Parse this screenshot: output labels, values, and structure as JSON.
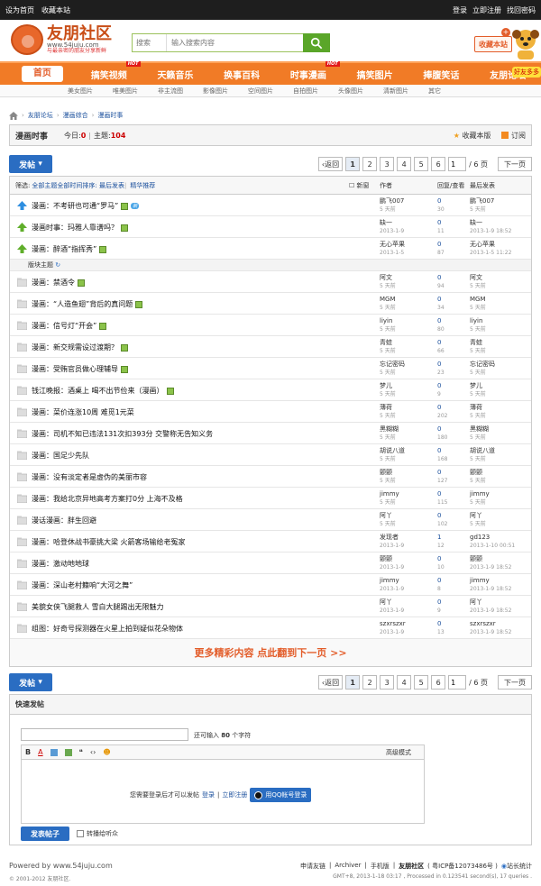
{
  "topbar": {
    "left": [
      "设为首页",
      "收藏本站"
    ],
    "right": [
      "登录",
      "立即注册",
      "找回密码"
    ]
  },
  "logo": {
    "title": "友朋社区",
    "url": "www.54juju.com",
    "slogan": "与最亲密的朋友分享新鲜"
  },
  "search": {
    "type": "搜索",
    "placeholder": "输入搜索内容"
  },
  "header": {
    "fav": "收藏本站",
    "badge": "好友多多"
  },
  "nav": [
    {
      "label": "首页",
      "hot": ""
    },
    {
      "label": "搞笑视频",
      "hot": "HOT"
    },
    {
      "label": "天籁音乐",
      "hot": ""
    },
    {
      "label": "换事百科",
      "hot": ""
    },
    {
      "label": "时事漫画",
      "hot": "HOT"
    },
    {
      "label": "搞笑图片",
      "hot": ""
    },
    {
      "label": "捧腹笑话",
      "hot": ""
    },
    {
      "label": "友朋论坛",
      "hot": ""
    }
  ],
  "subnav": [
    "美女图片",
    "唯美图片",
    "非主流图",
    "影像图片",
    "空间图片",
    "自拍图片",
    "头像图片",
    "清新图片",
    "其它"
  ],
  "breadcrumb": [
    "友朋论坛",
    "漫画综合",
    "漫画时事"
  ],
  "forum": {
    "title": "漫画时事",
    "today_label": "今日:",
    "today": "0",
    "topics_label": "主题:",
    "topics": "104",
    "fav": "收藏本版",
    "rss": "订阅"
  },
  "pager": {
    "post": "发帖",
    "back": "返回",
    "pages": [
      "1",
      "2",
      "3",
      "4",
      "5",
      "6"
    ],
    "current": "1",
    "total": "/ 6 页",
    "next": "下一页"
  },
  "filter": {
    "label": "筛选:",
    "all": "全部主题",
    "time": "全部时间",
    "sort": "排序: 最后发表",
    "digest": "精华",
    "recommend": "推荐",
    "newwin": "新窗",
    "col_author": "作者",
    "col_reply": "回复/查看",
    "col_last": "最后发表"
  },
  "sticky": [
    {
      "title": "漫画：不考研也可通“罗马”",
      "attach": true,
      "newt": true,
      "author": "鹏飞007",
      "adate": "5 天前",
      "r": "0",
      "v": "30",
      "last": "鹏飞007",
      "ldate": "5 天前"
    },
    {
      "title": "漫画时事：玛雅人靠谱吗？",
      "attach": true,
      "newt": false,
      "author": "缺一",
      "adate": "2013-1-9",
      "r": "0",
      "v": "11",
      "last": "缺一",
      "ldate": "2013-1-9 18:52"
    },
    {
      "title": "漫画：醉酒“指挥秀”",
      "attach": true,
      "newt": false,
      "author": "无心苹果",
      "adate": "2013-1-5",
      "r": "0",
      "v": "87",
      "last": "无心苹果",
      "ldate": "2013-1-5 11:22"
    }
  ],
  "section_label": "版块主题",
  "rows": [
    {
      "title": "漫画：禁酒令",
      "attach": true,
      "author": "阿文",
      "adate": "5 天前",
      "r": "0",
      "v": "94",
      "last": "阿文",
      "ldate": "5 天前"
    },
    {
      "title": "漫画：“人造鱼翅”背后的真问题",
      "attach": true,
      "author": "MGM",
      "adate": "5 天前",
      "r": "0",
      "v": "34",
      "last": "MGM",
      "ldate": "5 天前"
    },
    {
      "title": "漫画：信号灯“开会”",
      "attach": true,
      "author": "liyin",
      "adate": "5 天前",
      "r": "0",
      "v": "80",
      "last": "liyin",
      "ldate": "5 天前"
    },
    {
      "title": "漫画：新交规需设过渡期？",
      "attach": true,
      "author": "青蛙",
      "adate": "5 天前",
      "r": "0",
      "v": "66",
      "last": "青蛙",
      "ldate": "5 天前"
    },
    {
      "title": "漫画：受贿官员做心理辅导",
      "attach": true,
      "author": "忘记密码",
      "adate": "5 天前",
      "r": "0",
      "v": "23",
      "last": "忘记密码",
      "ldate": "5 天前"
    },
    {
      "title": "钱江晚报：酒桌上 喝不出节俭来（漫画）",
      "attach": true,
      "author": "梦儿",
      "adate": "5 天前",
      "r": "0",
      "v": "9",
      "last": "梦儿",
      "ldate": "5 天前"
    },
    {
      "title": "漫画：菜价连涨10周 难觅1元菜",
      "attach": false,
      "author": "薄荷",
      "adate": "5 天前",
      "r": "0",
      "v": "202",
      "last": "薄荷",
      "ldate": "5 天前"
    },
    {
      "title": "漫画：司机不知已违法131次扣393分 交警称无告知义务",
      "attach": false,
      "author": "黑糊糊",
      "adate": "5 天前",
      "r": "0",
      "v": "180",
      "last": "黑糊糊",
      "ldate": "5 天前"
    },
    {
      "title": "漫画：国足少先队",
      "attach": false,
      "author": "胡说八道",
      "adate": "5 天前",
      "r": "0",
      "v": "168",
      "last": "胡说八道",
      "ldate": "5 天前"
    },
    {
      "title": "漫画：没有淡定者是虚伪的美丽市容",
      "attach": false,
      "author": "颤颤",
      "adate": "5 天前",
      "r": "0",
      "v": "127",
      "last": "颤颤",
      "ldate": "5 天前"
    },
    {
      "title": "漫画：我给北京异地高考方案打0分 上海不及格",
      "attach": false,
      "author": "jimmy",
      "adate": "5 天前",
      "r": "0",
      "v": "115",
      "last": "jimmy",
      "ldate": "5 天前"
    },
    {
      "title": "漫话漫画：胖生回避",
      "attach": false,
      "author": "阿丫",
      "adate": "5 天前",
      "r": "0",
      "v": "102",
      "last": "阿丫",
      "ldate": "5 天前"
    },
    {
      "title": "漫画：哈登休战书豪挑大梁 火箭客场输给老冤家",
      "attach": false,
      "author": "发现者",
      "adate": "2013-1-9",
      "r": "1",
      "v": "12",
      "last": "gd123",
      "ldate": "2013-1-10 00:51"
    },
    {
      "title": "漫画：激动地地球",
      "attach": false,
      "author": "颤颤",
      "adate": "2013-1-9",
      "r": "0",
      "v": "10",
      "last": "颤颤",
      "ldate": "2013-1-9 18:52"
    },
    {
      "title": "漫画：深山老村籍响“大河之舞”",
      "attach": false,
      "author": "jimmy",
      "adate": "2013-1-9",
      "r": "0",
      "v": "8",
      "last": "jimmy",
      "ldate": "2013-1-9 18:52"
    },
    {
      "title": "美貌女侠飞腿救人 雪白大腿踢出无限魅力",
      "attach": false,
      "author": "阿丫",
      "adate": "2013-1-9",
      "r": "0",
      "v": "9",
      "last": "阿丫",
      "ldate": "2013-1-9 18:52"
    },
    {
      "title": "组图：好奇号探测器在火星上拍到疑似花朵物体",
      "attach": false,
      "author": "szxrszxr",
      "adate": "2013-1-9",
      "r": "0",
      "v": "13",
      "last": "szxrszxr",
      "ldate": "2013-1-9 18:52"
    }
  ],
  "more": "更多精彩内容 点此翻到下一页 >>",
  "quick": {
    "title": "快速发帖",
    "hint_pre": "还可输入",
    "hint_num": "80",
    "hint_post": "个字符",
    "adv": "高级模式",
    "login_msg": "您需要登录后才可以发帖",
    "login": "登录",
    "sep": "|",
    "register": "立即注册",
    "qq": "用QQ帐号登录",
    "submit": "发表帖子",
    "checkbox": "转播给听众"
  },
  "footer": {
    "powered": "Powered by www.54juju.com",
    "copyright": "© 2001-2012 友朋社区.",
    "links": [
      "申请友链",
      "|",
      "Archiver",
      "|",
      "手机版",
      "|",
      "友朋社区",
      "( 粤ICP备12073486号 )",
      "站长统计"
    ],
    "time": "GMT+8, 2013-1-18 03:17 , Processed in 0.123541 second(s), 17 queries ."
  }
}
